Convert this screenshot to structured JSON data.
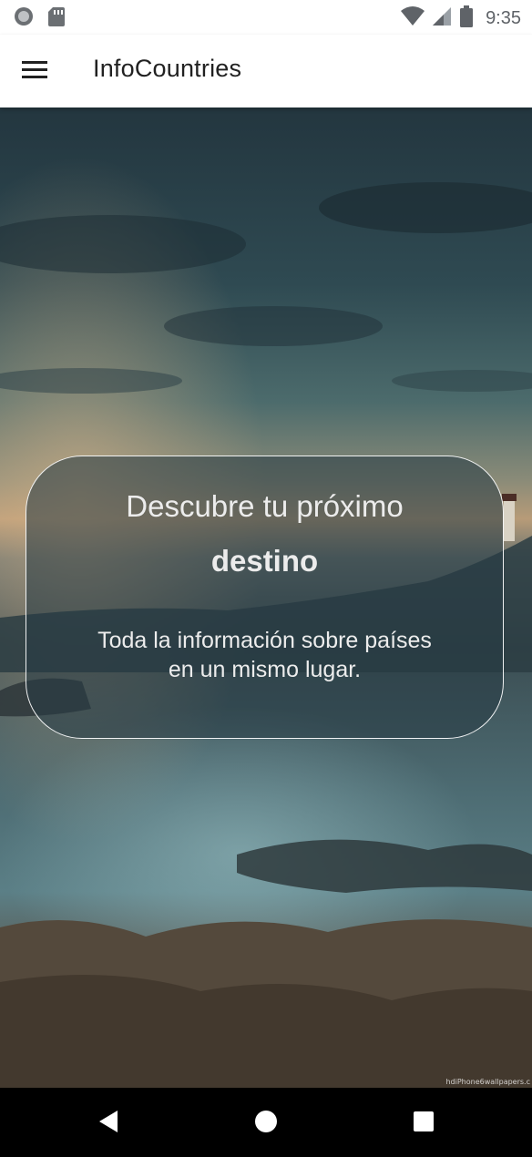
{
  "status_bar": {
    "time": "9:35",
    "icons": [
      "record-icon",
      "sd-card-icon",
      "wifi-icon",
      "cell-signal-icon",
      "battery-icon"
    ]
  },
  "app_bar": {
    "title": "InfoCountries",
    "menu_icon": "hamburger-menu-icon"
  },
  "hero": {
    "line1": "Descubre tu próximo",
    "line2": "destino",
    "subtitle": "Toda la información sobre países\nen un mismo lugar."
  },
  "background": {
    "watermark": "hdiPhone6wallpapers.c"
  },
  "nav_bar": {
    "icons": [
      "back-icon",
      "home-icon",
      "recents-icon"
    ]
  },
  "colors": {
    "app_bar_bg": "#ffffff",
    "title_text": "#212121",
    "status_icons": "#5f6368",
    "card_border": "#ffffff",
    "card_bg": "#263a44",
    "nav_bar_bg": "#000000"
  }
}
